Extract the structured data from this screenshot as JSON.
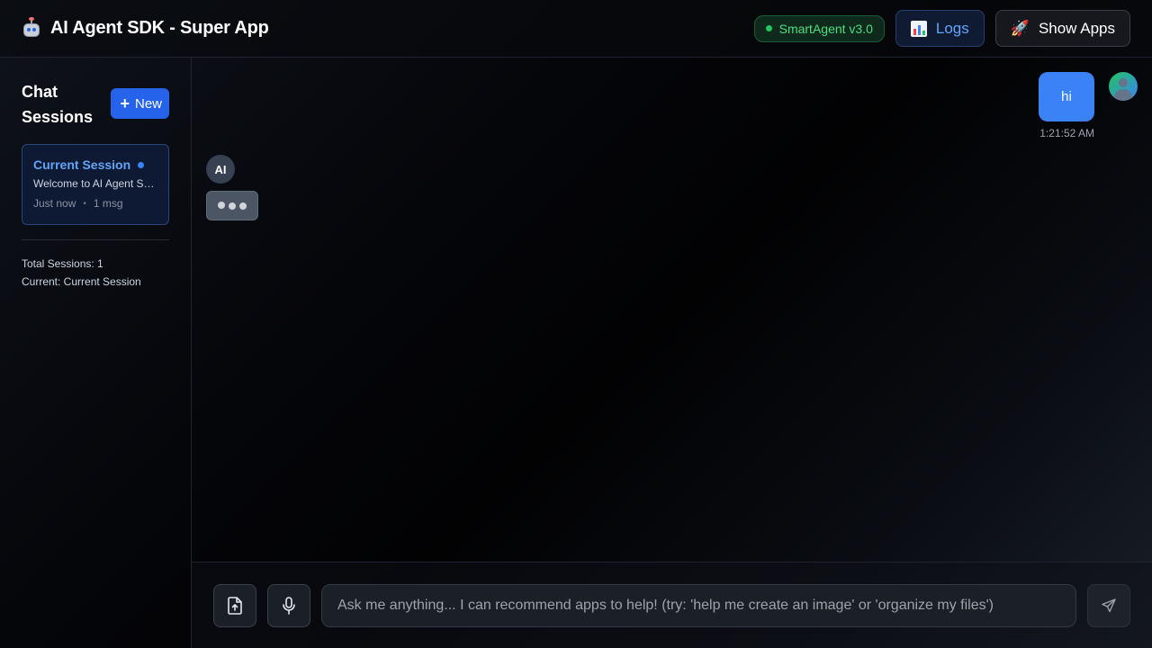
{
  "header": {
    "title": "AI Agent SDK - Super App",
    "agent_status": "SmartAgent v3.0",
    "logs_label": "Logs",
    "apps_label": "Show Apps"
  },
  "sidebar": {
    "title": "Chat Sessions",
    "new_label": "New",
    "sessions": [
      {
        "name": "Current Session",
        "preview": "Welcome to AI Agent SDK! I can help you…",
        "time": "Just now",
        "count": "1 msg",
        "active": true
      }
    ],
    "stats": {
      "total": "Total Sessions: 1",
      "current": "Current: Current Session"
    }
  },
  "chat": {
    "messages": [
      {
        "role": "user",
        "text": "hi",
        "time": "1:21:52 AM"
      }
    ],
    "ai_avatar_label": "AI",
    "ai_typing": true
  },
  "input": {
    "placeholder": "Ask me anything... I can recommend apps to help! (try: 'help me create an image' or 'organize my files')",
    "value": ""
  },
  "icons": {
    "brand": "robot-icon",
    "logs": "bar-chart-icon",
    "apps": "rocket-icon",
    "new": "plus-icon",
    "upload": "file-upload-icon",
    "voice": "microphone-icon",
    "send": "send-icon"
  },
  "colors": {
    "accent": "#2563eb",
    "user_bubble": "#3b82f6",
    "status_green": "#22c55e",
    "logs_text": "#60a5fa"
  }
}
